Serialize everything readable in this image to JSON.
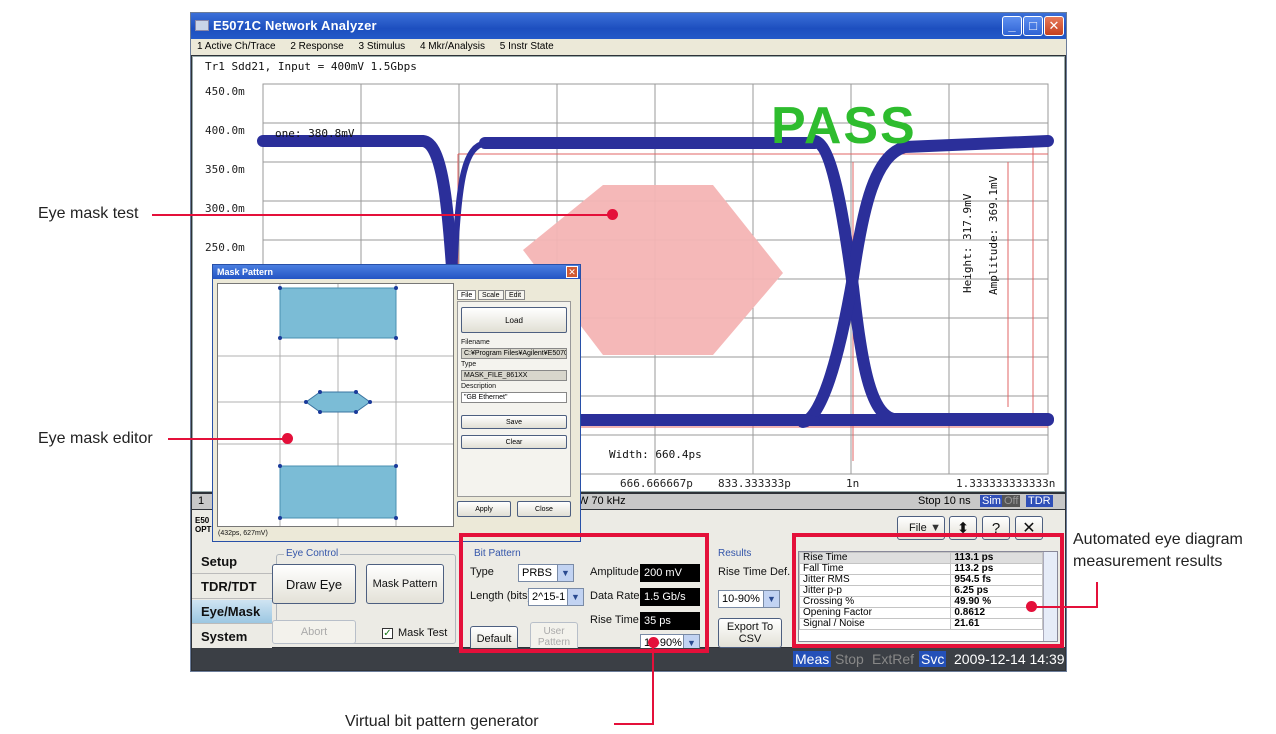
{
  "window": {
    "title": "E5071C Network Analyzer",
    "menu": [
      "1 Active Ch/Trace",
      "2 Response",
      "3 Stimulus",
      "4 Mkr/Analysis",
      "5 Instr State"
    ]
  },
  "plot": {
    "trace_label": "Tr1 Sdd21, Input = 400mV 1.5Gbps",
    "y_ticks": [
      "450.0m",
      "400.0m",
      "350.0m",
      "300.0m",
      "250.0m"
    ],
    "x_ticks": [
      "666.666667p",
      "833.333333p",
      "1n",
      "1.333333333333n"
    ],
    "one_level": "one: 380.8mV",
    "width": "Width: 660.4ps",
    "height": "Height: 317.9mV",
    "amplitude": "Amplitude: 369.1mV",
    "verdict": "PASS",
    "colors": {
      "trace": "#2b2f9a",
      "mask": "#f4b4b4",
      "pass": "#2ebc2e"
    }
  },
  "status_row": {
    "left_fragment": "1",
    "middle_fragment": "W 70 kHz",
    "stop": "Stop 10 ns",
    "sim": "Sim",
    "off": "Off",
    "tdr": "TDR"
  },
  "panel": {
    "model_fragment": "E50",
    "opt_fragment": "OPT",
    "tabs": [
      "Setup",
      "TDR/TDT",
      "Eye/Mask",
      "System"
    ],
    "active_tab": "Eye/Mask",
    "top_buttons": {
      "file": "File",
      "help": "?"
    },
    "eye_control": {
      "label": "Eye Control",
      "draw_eye": "Draw Eye",
      "mask_pattern": "Mask Pattern",
      "abort": "Abort",
      "mask_test": "Mask Test",
      "mask_test_checked": true
    },
    "bit_pattern": {
      "label": "Bit Pattern",
      "type_label": "Type",
      "type_value": "PRBS",
      "length_label": "Length (bits)",
      "length_value": "2^15-1",
      "amplitude_label": "Amplitude",
      "amplitude_value": "200 mV",
      "data_rate_label": "Data Rate",
      "data_rate_value": "1.5 Gb/s",
      "rise_time_label": "Rise Time",
      "rise_time_value": "35 ps",
      "rise_def_value": "10-90%",
      "default_button": "Default",
      "user_pattern_button": "User Pattern"
    },
    "results_group": {
      "label": "Results",
      "rise_time_def_label": "Rise Time Def.",
      "rise_time_def_value": "10-90%",
      "export_button": "Export To CSV"
    },
    "results_table": [
      {
        "name": "Rise Time",
        "value": "113.1 ps"
      },
      {
        "name": "Fall Time",
        "value": "113.2 ps"
      },
      {
        "name": "Jitter RMS",
        "value": "954.5 fs"
      },
      {
        "name": "Jitter p-p",
        "value": "6.25 ps"
      },
      {
        "name": "Crossing %",
        "value": "49.90 %"
      },
      {
        "name": "Opening Factor",
        "value": "0.8612"
      },
      {
        "name": "Signal / Noise",
        "value": "21.61"
      }
    ]
  },
  "bottom_bar": {
    "meas": "Meas",
    "stop": "Stop",
    "extref": "ExtRef",
    "svc": "Svc",
    "datetime": "2009-12-14 14:39"
  },
  "mask_dialog": {
    "title": "Mask Pattern",
    "tabs": [
      "File",
      "Scale",
      "Edit"
    ],
    "load": "Load",
    "filename_label": "Filename",
    "filename_value": "C:¥Program Files¥Agilent¥E5070¥Tn",
    "type_label": "Type",
    "type_value": "MASK_FILE_861XX",
    "description_label": "Description",
    "description_value": "\"GB Ethernet\"",
    "save": "Save",
    "clear": "Clear",
    "apply": "Apply",
    "close": "Close",
    "cursor_readout": "(432ps, 627mV)"
  },
  "callouts": {
    "eye_mask_test": "Eye mask test",
    "eye_mask_editor": "Eye mask editor",
    "results_line1": "Automated eye diagram",
    "results_line2": "measurement results",
    "bit_pattern": "Virtual bit pattern generator"
  },
  "accent": "#e4103a"
}
